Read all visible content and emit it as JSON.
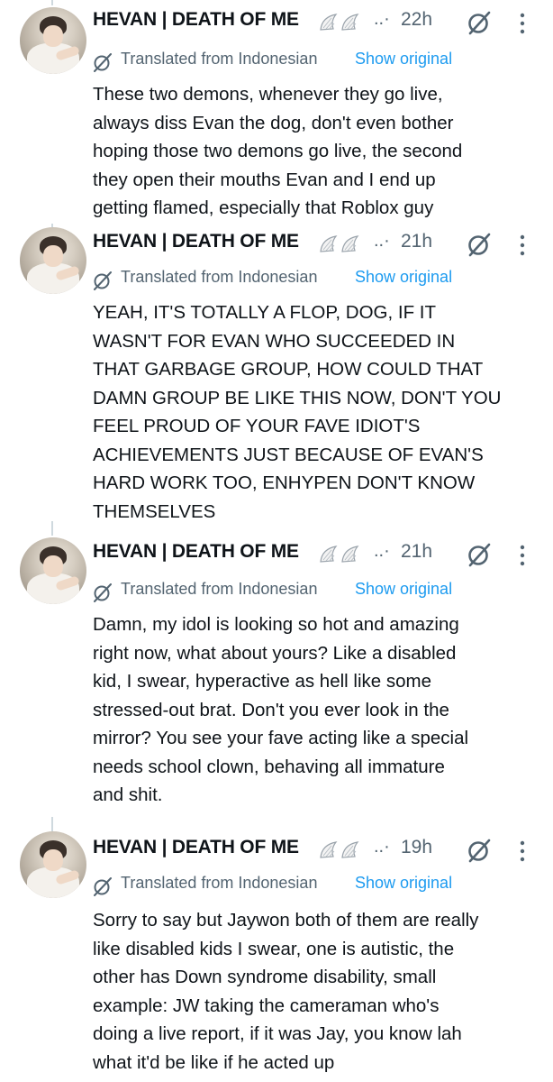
{
  "posts": [
    {
      "author": "HEVAN | DEATH OF ME",
      "dots": "..·",
      "time": "22h",
      "translated_label": "Translated from Indonesian",
      "show_original": "Show original",
      "lines": [
        "These two demons, whenever they go live,",
        "always diss Evan the dog, don't even bother",
        "hoping those two demons go live, the second",
        "they open their mouths Evan and I end up",
        "getting flamed, especially that Roblox guy"
      ]
    },
    {
      "author": "HEVAN | DEATH OF ME",
      "dots": "..·",
      "time": "21h",
      "translated_label": "Translated from Indonesian",
      "show_original": "Show original",
      "lines": [
        "YEAH, IT'S TOTALLY A FLOP, DOG, IF IT",
        "WASN'T FOR EVAN WHO SUCCEEDED IN",
        "THAT GARBAGE GROUP, HOW COULD THAT",
        "DAMN GROUP BE LIKE THIS NOW, DON'T YOU",
        "FEEL PROUD OF YOUR FAVE IDIOT'S",
        "ACHIEVEMENTS JUST BECAUSE OF EVAN'S",
        "HARD WORK TOO, ENHYPEN DON'T KNOW",
        "THEMSELVES"
      ]
    },
    {
      "author": "HEVAN | DEATH OF ME",
      "dots": "..·",
      "time": "21h",
      "translated_label": "Translated from Indonesian",
      "show_original": "Show original",
      "lines": [
        "Damn, my idol is looking so hot and amazing",
        "right now, what about yours? Like a disabled",
        "kid, I swear, hyperactive as hell like some",
        "stressed-out brat. Don't you ever look in the",
        "mirror? You see your fave acting like a special",
        "needs school clown, behaving all immature",
        "and shit."
      ]
    },
    {
      "author": "HEVAN | DEATH OF ME",
      "dots": "..·",
      "time": "19h",
      "translated_label": "Translated from Indonesian",
      "show_original": "Show original",
      "lines": [
        "Sorry to say but Jaywon both of them are really",
        "like disabled kids I swear, one is autistic, the",
        "other has Down syndrome disability, small",
        "example: JW taking the cameraman who's",
        "doing a live report, if it was Jay, you know lah",
        "what it'd be like if he acted up"
      ]
    }
  ],
  "colors": {
    "text": "#0f1419",
    "muted": "#536471",
    "link": "#1d9bf0",
    "thread_line": "#cfd9de"
  },
  "icons": {
    "avatar": "profile-photo",
    "wings": "angel-wings-emoji",
    "grok": "grok-slash-circle-icon",
    "more": "vertical-ellipsis-icon",
    "translate": "grok-translate-icon"
  }
}
